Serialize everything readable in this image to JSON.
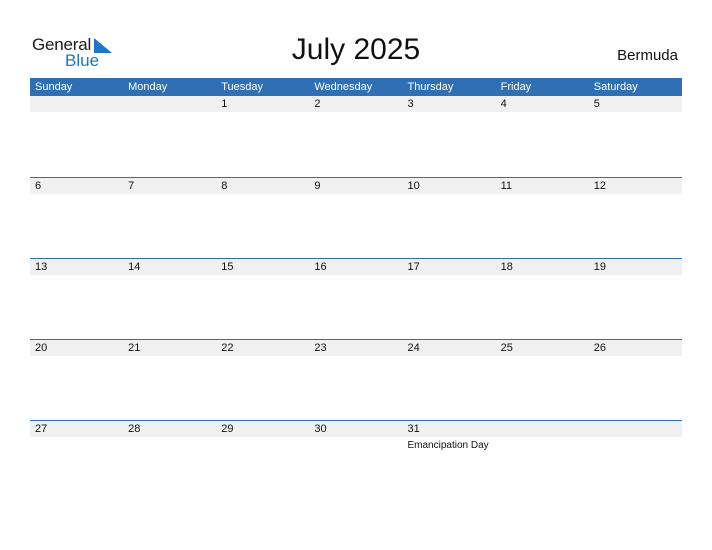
{
  "logo": {
    "word1": "General",
    "word2": "Blue",
    "icon": "blue-triangle-icon"
  },
  "header": {
    "title": "July 2025",
    "country": "Bermuda"
  },
  "colors": {
    "accent": "#2f70b5",
    "strip": "#f0f0f0",
    "logo_blue": "#1d76c6"
  },
  "weekdays": [
    "Sunday",
    "Monday",
    "Tuesday",
    "Wednesday",
    "Thursday",
    "Friday",
    "Saturday"
  ],
  "weeks": [
    {
      "days": [
        {
          "n": "",
          "ev": ""
        },
        {
          "n": "",
          "ev": ""
        },
        {
          "n": "1",
          "ev": ""
        },
        {
          "n": "2",
          "ev": ""
        },
        {
          "n": "3",
          "ev": ""
        },
        {
          "n": "4",
          "ev": ""
        },
        {
          "n": "5",
          "ev": ""
        }
      ]
    },
    {
      "days": [
        {
          "n": "6",
          "ev": ""
        },
        {
          "n": "7",
          "ev": ""
        },
        {
          "n": "8",
          "ev": ""
        },
        {
          "n": "9",
          "ev": ""
        },
        {
          "n": "10",
          "ev": ""
        },
        {
          "n": "11",
          "ev": ""
        },
        {
          "n": "12",
          "ev": ""
        }
      ]
    },
    {
      "days": [
        {
          "n": "13",
          "ev": ""
        },
        {
          "n": "14",
          "ev": ""
        },
        {
          "n": "15",
          "ev": ""
        },
        {
          "n": "16",
          "ev": ""
        },
        {
          "n": "17",
          "ev": ""
        },
        {
          "n": "18",
          "ev": ""
        },
        {
          "n": "19",
          "ev": ""
        }
      ]
    },
    {
      "days": [
        {
          "n": "20",
          "ev": ""
        },
        {
          "n": "21",
          "ev": ""
        },
        {
          "n": "22",
          "ev": ""
        },
        {
          "n": "23",
          "ev": ""
        },
        {
          "n": "24",
          "ev": ""
        },
        {
          "n": "25",
          "ev": ""
        },
        {
          "n": "26",
          "ev": ""
        }
      ]
    },
    {
      "days": [
        {
          "n": "27",
          "ev": ""
        },
        {
          "n": "28",
          "ev": ""
        },
        {
          "n": "29",
          "ev": ""
        },
        {
          "n": "30",
          "ev": ""
        },
        {
          "n": "31",
          "ev": "Emancipation Day"
        },
        {
          "n": "",
          "ev": ""
        },
        {
          "n": "",
          "ev": ""
        }
      ]
    }
  ]
}
